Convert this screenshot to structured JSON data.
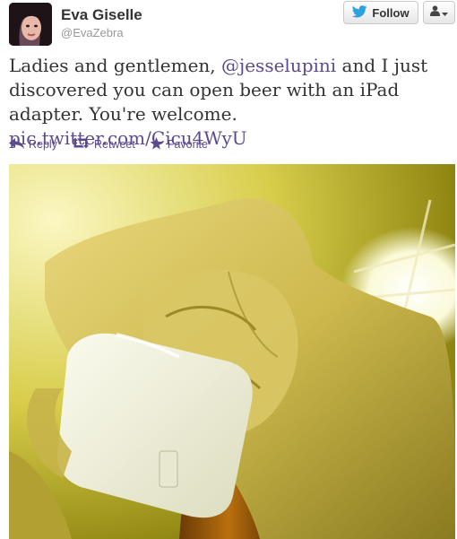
{
  "user": {
    "name": "Eva Giselle",
    "handle": "@EvaZebra"
  },
  "buttons": {
    "follow_label": "Follow"
  },
  "tweet": {
    "text_1": "Ladies and gentlemen, ",
    "mention": "@jesselupini",
    "text_2": " and I just discovered you can open beer with an iPad adapter. You're welcome. ",
    "pic_link": "pic.twitter.com/Cicu4WyU"
  },
  "actions": {
    "reply": "Reply",
    "retweet": "Retweet",
    "favorite": "Favorite"
  },
  "icons": {
    "follow": "bird-icon",
    "user_menu": "person-icon",
    "reply": "reply-arrow-icon",
    "retweet": "retweet-icon",
    "favorite": "star-icon"
  },
  "colors": {
    "link": "#5c4a8f",
    "twitter_blue": "#2da2e1"
  }
}
